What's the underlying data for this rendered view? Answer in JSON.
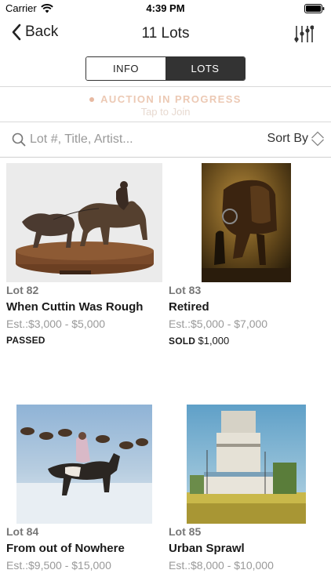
{
  "status_bar": {
    "carrier": "Carrier",
    "time": "4:39 PM"
  },
  "nav": {
    "back_label": "Back",
    "title": "11 Lots"
  },
  "tabs": [
    {
      "label": "INFO",
      "selected": false
    },
    {
      "label": "LOTS",
      "selected": true
    }
  ],
  "auction": {
    "status": "AUCTION IN PROGRESS",
    "subtitle": "Tap to Join",
    "status_color": "#ecc9b4"
  },
  "search": {
    "placeholder": "Lot #, Title, Artist...",
    "value": ""
  },
  "sort": {
    "label": "Sort By"
  },
  "lots": [
    {
      "number": "Lot 82",
      "title": "When Cuttin Was Rough",
      "estimate": "Est.:$3,000 - $5,000",
      "result_label": "PASSED",
      "result_amount": ""
    },
    {
      "number": "Lot 83",
      "title": "Retired",
      "estimate": "Est.:$5,000 - $7,000",
      "result_label": "SOLD",
      "result_amount": "$1,000"
    },
    {
      "number": "Lot 84",
      "title": "From out of Nowhere",
      "estimate": "Est.:$9,500 - $15,000",
      "result_label": "",
      "result_amount": ""
    },
    {
      "number": "Lot 85",
      "title": "Urban Sprawl",
      "estimate": "Est.:$8,000 - $10,000",
      "result_label": "",
      "result_amount": ""
    }
  ],
  "icons": {
    "wifi": "wifi-icon",
    "battery": "battery-icon",
    "back": "chevron-left-icon",
    "filter": "sliders-icon",
    "search": "search-icon",
    "sort": "sort-chevrons-icon"
  }
}
